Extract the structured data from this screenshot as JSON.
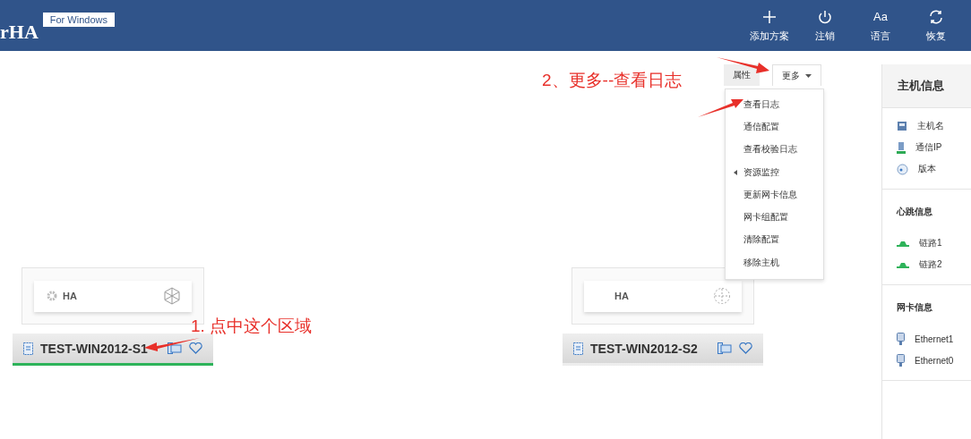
{
  "header": {
    "logo": "rHA",
    "badge": "For Windows",
    "actions": [
      {
        "label": "添加方案",
        "kind": "plus"
      },
      {
        "label": "注销",
        "kind": "power"
      },
      {
        "label": "语言",
        "kind": "text",
        "glyph": "Aa"
      },
      {
        "label": "恢复",
        "kind": "refresh"
      }
    ]
  },
  "hosts": [
    {
      "name": "TEST-WIN2012-S1",
      "selected": true,
      "service": {
        "label": "HA",
        "kind": "running"
      }
    },
    {
      "name": "TEST-WIN2012-S2",
      "selected": false,
      "service": {
        "label": "HA",
        "kind": "stopped"
      }
    }
  ],
  "tabs": [
    {
      "label": "属性",
      "selected": false
    },
    {
      "label": "更多",
      "selected": true
    }
  ],
  "menu": [
    {
      "label": "查看日志",
      "kind": "action"
    },
    {
      "label": "通信配置",
      "kind": "action"
    },
    {
      "label": "查看校验日志",
      "kind": "action"
    },
    {
      "label": "资源监控",
      "kind": "submenu"
    },
    {
      "label": "更新网卡信息",
      "kind": "action"
    },
    {
      "label": "网卡组配置",
      "kind": "action"
    },
    {
      "label": "清除配置",
      "kind": "action"
    },
    {
      "label": "移除主机",
      "kind": "action"
    }
  ],
  "annotations": [
    "1. 点中这个区域",
    "2、更多--查看日志"
  ],
  "panel": {
    "title": "主机信息",
    "sections": [
      {
        "items": [
          {
            "label": "主机名",
            "kind": "server"
          },
          {
            "label": "通信IP",
            "kind": "ip"
          },
          {
            "label": "版本",
            "kind": "disc"
          }
        ]
      },
      {
        "heading": "心跳信息",
        "items": [
          {
            "label": "链路1",
            "kind": "link"
          },
          {
            "label": "链路2",
            "kind": "link"
          }
        ]
      },
      {
        "heading": "网卡信息",
        "items": [
          {
            "label": "Ethernet1",
            "kind": "nic"
          },
          {
            "label": "Ethernet0",
            "kind": "nic"
          }
        ]
      }
    ]
  }
}
